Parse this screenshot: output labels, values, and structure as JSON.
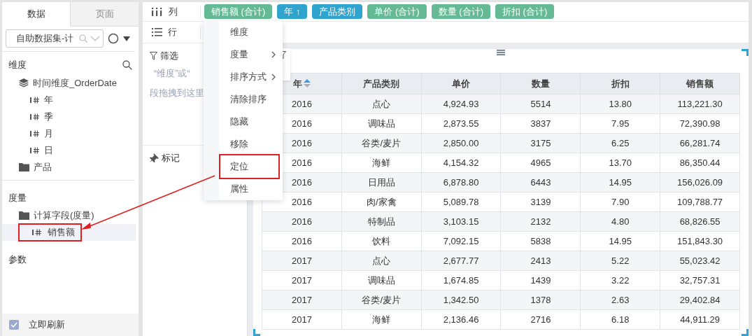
{
  "left_panel": {
    "tabs": [
      {
        "label": "数据",
        "selected": true
      },
      {
        "label": "页面",
        "selected": false
      }
    ],
    "dataset_select": {
      "value": "自助数据集-计"
    },
    "dimensions": {
      "title": "维度",
      "items": [
        {
          "kind": "time",
          "label": "时间维度_OrderDate",
          "children": [
            {
              "kind": "field",
              "label": "年",
              "selected": false,
              "annotated": false
            },
            {
              "kind": "field",
              "label": "季",
              "selected": false,
              "annotated": false
            },
            {
              "kind": "field",
              "label": "月",
              "selected": false,
              "annotated": false
            },
            {
              "kind": "field",
              "label": "日",
              "selected": false,
              "annotated": false
            }
          ]
        },
        {
          "kind": "folder",
          "label": "产品"
        }
      ]
    },
    "measures": {
      "title": "度量",
      "items": [
        {
          "kind": "folder",
          "label": "计算字段(度量)",
          "children": [
            {
              "kind": "field",
              "label": "销售额",
              "selected": true,
              "annotated": true
            }
          ]
        }
      ]
    },
    "parameters": {
      "title": "参数"
    },
    "auto_refresh": {
      "label": "立即刷新",
      "checked": true
    }
  },
  "shelves": {
    "columns": {
      "label": "列",
      "pills": [
        {
          "label": "销售额 (合计)",
          "kind": "measure"
        },
        {
          "label": "年 ↑",
          "kind": "dimension"
        },
        {
          "label": "产品类别",
          "kind": "dimension"
        },
        {
          "label": "单价 (合计)",
          "kind": "measure"
        },
        {
          "label": "数量 (合计)",
          "kind": "measure"
        },
        {
          "label": "折扣 (合计)",
          "kind": "measure"
        }
      ]
    },
    "rows": {
      "label": "行"
    }
  },
  "filter": {
    "title": "筛选",
    "hint_lines": [
      "“维度”或“",
      "段拖拽到这里"
    ]
  },
  "marks": {
    "title": "标记"
  },
  "context_menu": {
    "items": [
      {
        "label": "维度",
        "submenu": false,
        "annotated": false
      },
      {
        "label": "度量",
        "submenu": true,
        "annotated": false
      },
      {
        "label": "排序方式",
        "submenu": true,
        "annotated": false
      },
      {
        "label": "清除排序",
        "submenu": false,
        "annotated": false
      },
      {
        "label": "隐藏",
        "submenu": false,
        "annotated": false
      },
      {
        "label": "移除",
        "submenu": false,
        "annotated": false
      },
      {
        "label": "定位",
        "submenu": false,
        "annotated": true
      },
      {
        "label": "属性",
        "submenu": false,
        "annotated": false
      }
    ]
  },
  "table": {
    "columns": [
      {
        "label": "年",
        "sort_ascending": true
      },
      {
        "label": "产品类别"
      },
      {
        "label": "单价"
      },
      {
        "label": "数量"
      },
      {
        "label": "折扣"
      },
      {
        "label": "销售额"
      }
    ],
    "rows": [
      [
        "2016",
        "点心",
        "4,924.93",
        "5514",
        "13.80",
        "113,221.30"
      ],
      [
        "2016",
        "调味品",
        "2,873.55",
        "3837",
        "7.95",
        "72,390.98"
      ],
      [
        "2016",
        "谷类/麦片",
        "2,850.00",
        "3175",
        "6.25",
        "66,281.74"
      ],
      [
        "2016",
        "海鲜",
        "4,154.32",
        "4965",
        "13.70",
        "86,350.44"
      ],
      [
        "2016",
        "日用品",
        "6,878.80",
        "6443",
        "14.95",
        "156,026.09"
      ],
      [
        "2016",
        "肉/家禽",
        "5,089.78",
        "3139",
        "7.90",
        "109,788.77"
      ],
      [
        "2016",
        "特制品",
        "3,103.15",
        "2132",
        "4.80",
        "68,826.55"
      ],
      [
        "2016",
        "饮料",
        "7,092.15",
        "5838",
        "14.95",
        "151,843.30"
      ],
      [
        "2017",
        "点心",
        "2,677.77",
        "2413",
        "5.22",
        "55,023.42"
      ],
      [
        "2017",
        "调味品",
        "1,674.85",
        "1439",
        "3.22",
        "32,757.31"
      ],
      [
        "2017",
        "谷类/麦片",
        "1,342.50",
        "1378",
        "2.63",
        "29,402.84"
      ],
      [
        "2017",
        "海鲜",
        "2,136.46",
        "2716",
        "6.18",
        "44,911.29"
      ]
    ]
  }
}
